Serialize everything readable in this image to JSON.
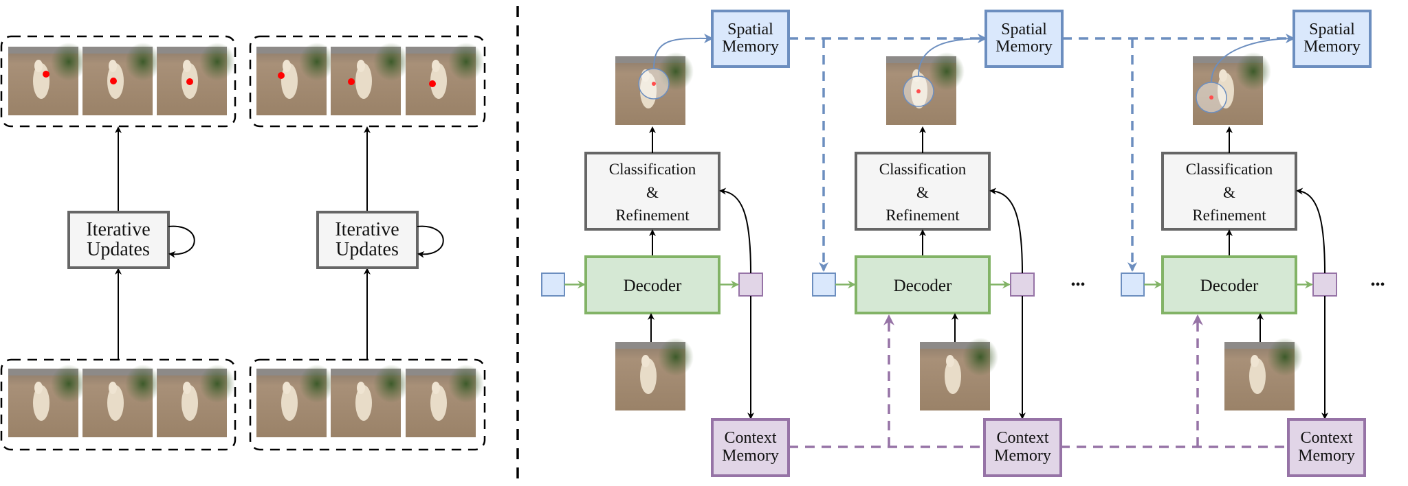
{
  "left_panel": {
    "iterative_label_line1": "Iterative",
    "iterative_label_line2": "Updates"
  },
  "right_panel": {
    "spatial_memory_line1": "Spatial",
    "spatial_memory_line2": "Memory",
    "context_memory_line1": "Context",
    "context_memory_line2": "Memory",
    "classification_line1": "Classification",
    "classification_line2": "&",
    "classification_line3": "Refinement",
    "decoder_label": "Decoder",
    "ellipsis": "•••"
  },
  "colors": {
    "spatial_fill": "#dae8fc",
    "spatial_stroke": "#6c8ebf",
    "decoder_fill": "#d5e8d4",
    "decoder_stroke": "#82b366",
    "context_fill": "#e1d5e7",
    "context_stroke": "#9673a6",
    "classification_fill": "#f5f5f5",
    "classification_stroke": "#666666",
    "point_marker": "#ff0000"
  }
}
